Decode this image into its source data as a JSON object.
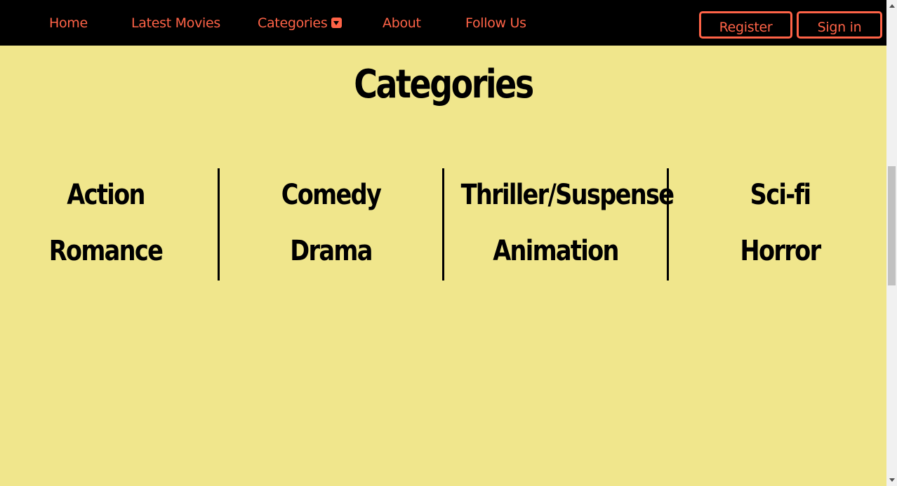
{
  "nav": {
    "links": [
      {
        "label": "Home"
      },
      {
        "label": "Latest Movies"
      },
      {
        "label": "Categories"
      },
      {
        "label": "About"
      },
      {
        "label": "Follow Us"
      }
    ],
    "register_label": "Register",
    "signin_label": "Sign in",
    "dropdown_icon": "caret-down-square-icon"
  },
  "page": {
    "title": "Categories"
  },
  "categories": {
    "columns": [
      {
        "items": [
          "Action",
          "Romance"
        ]
      },
      {
        "items": [
          "Comedy",
          "Drama"
        ]
      },
      {
        "items": [
          "Thriller/Suspense",
          "Animation"
        ]
      },
      {
        "items": [
          "Sci-fi",
          "Horror"
        ]
      }
    ]
  },
  "theme": {
    "background": "#f0e68c",
    "navbar": "#000000",
    "accent": "#ff6347",
    "text": "#000000"
  }
}
